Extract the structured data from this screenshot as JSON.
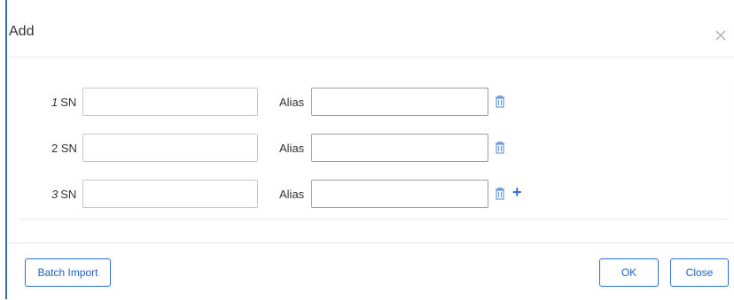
{
  "dialog": {
    "title": "Add"
  },
  "rows": [
    {
      "index": "1",
      "sn_label": "SN",
      "sn_value": "",
      "alias_label": "Alias",
      "alias_value": ""
    },
    {
      "index": "2",
      "sn_label": "SN",
      "sn_value": "",
      "alias_label": "Alias",
      "alias_value": ""
    },
    {
      "index": "3",
      "sn_label": "SN",
      "sn_value": "",
      "alias_label": "Alias",
      "alias_value": ""
    }
  ],
  "icons": {
    "close": "close-icon",
    "delete": "trash-icon",
    "add": "plus-icon",
    "add_glyph": "+"
  },
  "footer": {
    "batch_import_label": "Batch Import",
    "ok_label": "OK",
    "close_label": "Close"
  },
  "colors": {
    "accent": "#2f6fd8",
    "dialog_border": "#2f6fb4",
    "icon": "#5b8fe0"
  }
}
